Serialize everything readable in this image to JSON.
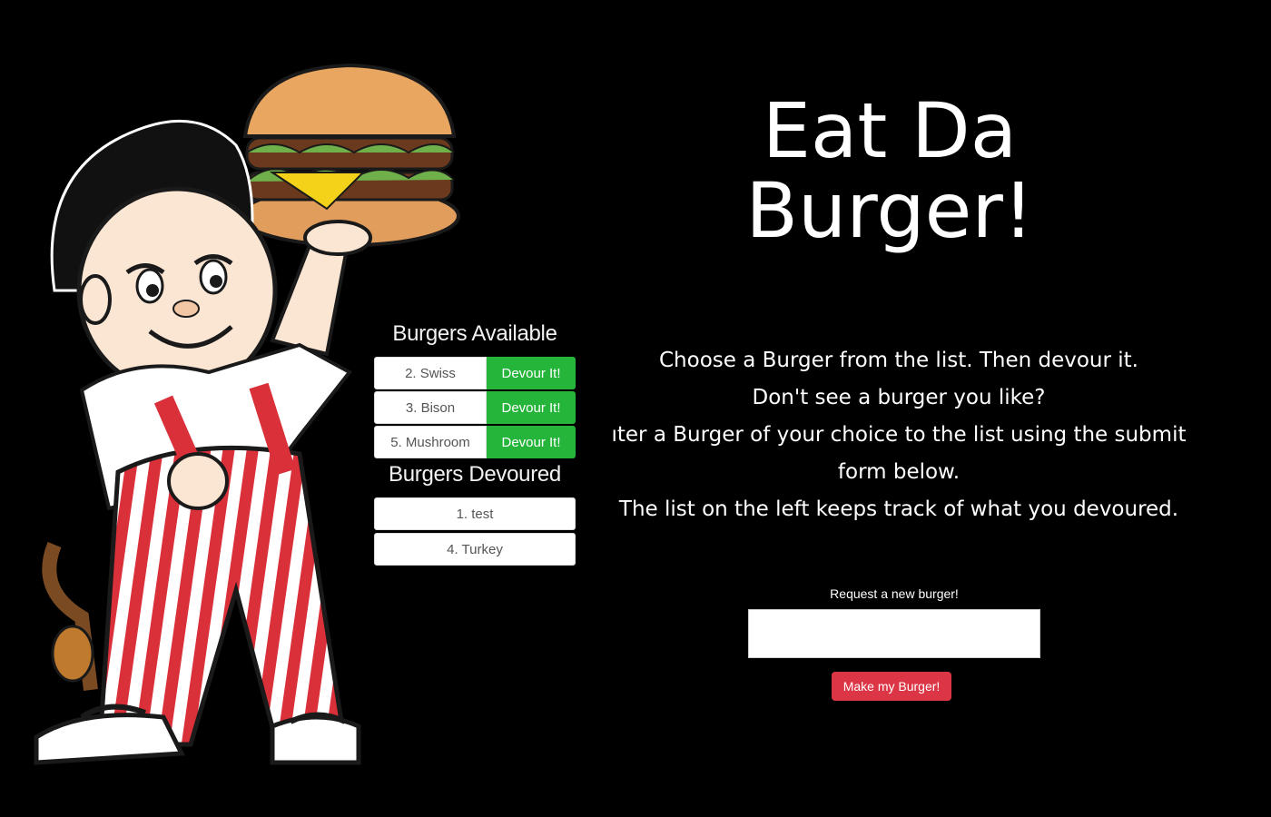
{
  "header": {
    "title_line1": "Eat Da",
    "title_line2": "Burger!"
  },
  "intro": {
    "line1": "Choose a Burger from the list. Then devour it.",
    "line2": "Don't see a burger you like?",
    "line3": "ıter a Burger of your choice to the list using the submit",
    "line4": "form below.",
    "line5": "The list on the left keeps track of what you devoured."
  },
  "available": {
    "title": "Burgers Available",
    "items": [
      {
        "label": "2. Swiss",
        "button": "Devour It!"
      },
      {
        "label": "3. Bison",
        "button": "Devour It!"
      },
      {
        "label": "5. Mushroom",
        "button": "Devour It!"
      }
    ]
  },
  "devoured": {
    "title": "Burgers Devoured",
    "items": [
      {
        "label": "1. test"
      },
      {
        "label": "4. Turkey"
      }
    ]
  },
  "form": {
    "label": "Request a new burger!",
    "input_value": "",
    "input_placeholder": "",
    "submit_label": "Make my Burger!"
  },
  "colors": {
    "background": "#000000",
    "devour_button": "#25b53a",
    "submit_button": "#dc3545"
  },
  "icons": {
    "mascot": "burger-mascot-illustration"
  }
}
